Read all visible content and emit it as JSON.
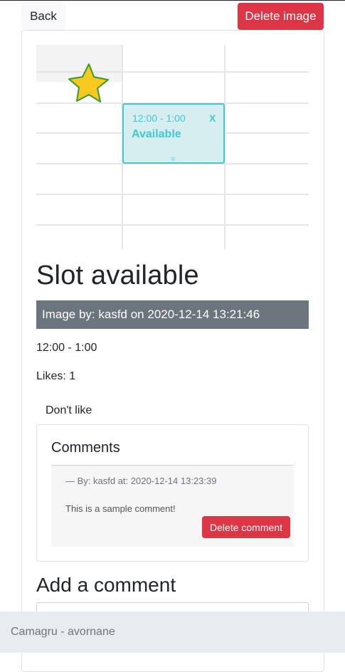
{
  "toolbar": {
    "back_label": "Back",
    "delete_image_label": "Delete image"
  },
  "image": {
    "slot_time": "12:00 - 1:00",
    "slot_close": "X",
    "slot_status": "Available",
    "slot_handle": "=",
    "sticker": "star-sticker",
    "colors": {
      "slot_fill": "#d6eef0",
      "slot_border": "#41c9cf",
      "star_fill": "#f7c820",
      "star_stroke": "#3a9b2a"
    }
  },
  "post": {
    "title": "Slot available",
    "byline": "Image by: kasfd on 2020-12-14 13:21:46",
    "description": "12:00 - 1:00",
    "likes": "Likes: 1",
    "dont_like_label": "Don't like"
  },
  "comments": {
    "title": "Comments",
    "items": [
      {
        "meta": "— By: kasfd at: 2020-12-14 13:23:39",
        "text": "This is a sample comment!",
        "delete_label": "Delete comment"
      }
    ]
  },
  "add_comment": {
    "title": "Add a comment"
  },
  "footer": {
    "text": "Camagru - avornane"
  },
  "colors": {
    "danger": "#dc3545",
    "secondary": "#6c757d",
    "light": "#f8f9fa",
    "footer_bg": "#e9ecef"
  }
}
